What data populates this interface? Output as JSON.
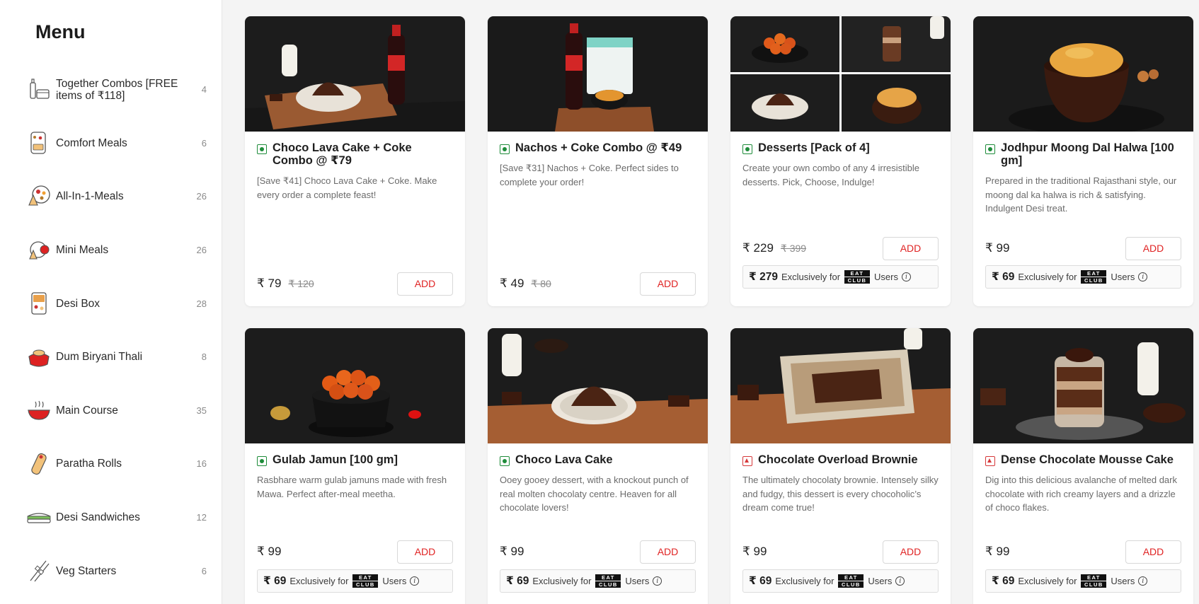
{
  "sidebar": {
    "title": "Menu",
    "categories": [
      {
        "label": "Together Combos [FREE items of ₹118]",
        "count": "4",
        "icon": "combo-icon"
      },
      {
        "label": "Comfort Meals",
        "count": "6",
        "icon": "meal-box-icon"
      },
      {
        "label": "All-In-1-Meals",
        "count": "26",
        "icon": "all-in-one-meal-icon"
      },
      {
        "label": "Mini Meals",
        "count": "26",
        "icon": "mini-meal-icon"
      },
      {
        "label": "Desi Box",
        "count": "28",
        "icon": "desi-box-icon"
      },
      {
        "label": "Dum Biryani Thali",
        "count": "8",
        "icon": "biryani-pot-icon"
      },
      {
        "label": "Main Course",
        "count": "35",
        "icon": "curry-bowl-icon"
      },
      {
        "label": "Paratha Rolls",
        "count": "16",
        "icon": "roll-icon"
      },
      {
        "label": "Desi Sandwiches",
        "count": "12",
        "icon": "sandwich-icon"
      },
      {
        "label": "Veg Starters",
        "count": "6",
        "icon": "skewer-icon"
      }
    ]
  },
  "eatclub": {
    "exclusive_text": "Exclusively for",
    "users_text": "Users",
    "logo_top": "EAT",
    "logo_bottom": "CLUB"
  },
  "add_label": "ADD",
  "items": [
    {
      "title": "Choco Lava Cake + Coke Combo @ ₹79",
      "desc": "[Save ₹41] Choco Lava Cake + Coke. Make every order a complete feast!",
      "price": "₹ 79",
      "mrp": "₹ 120",
      "eat_price": "",
      "type": "veg",
      "image": "choco-lava-coke-photo"
    },
    {
      "title": "Nachos + Coke Combo @ ₹49",
      "desc": "[Save ₹31] Nachos + Coke. Perfect sides to complete your order!",
      "price": "₹ 49",
      "mrp": "₹ 80",
      "eat_price": "",
      "type": "veg",
      "image": "nachos-coke-photo"
    },
    {
      "title": "Desserts [Pack of 4]",
      "desc": "Create your own combo of any 4 irresistible desserts. Pick, Choose, Indulge!",
      "price": "₹ 229",
      "mrp": "₹ 399",
      "eat_price": "₹ 279",
      "type": "veg",
      "image": "dessert-collage-photo"
    },
    {
      "title": "Jodhpur Moong Dal Halwa [100 gm]",
      "desc": "Prepared in the traditional Rajasthani style, our moong dal ka halwa is rich & satisfying. Indulgent Desi treat.",
      "price": "₹ 99",
      "mrp": "",
      "eat_price": "₹ 69",
      "type": "veg",
      "image": "moong-dal-halwa-photo"
    },
    {
      "title": "Gulab Jamun [100 gm]",
      "desc": "Rasbhare warm gulab jamuns made with fresh Mawa. Perfect after-meal meetha.",
      "price": "₹ 99",
      "mrp": "",
      "eat_price": "₹ 69",
      "type": "veg",
      "image": "gulab-jamun-photo"
    },
    {
      "title": "Choco Lava Cake",
      "desc": "Ooey gooey dessert, with a knockout punch of real molten chocolaty centre. Heaven for all chocolate lovers!",
      "price": "₹ 99",
      "mrp": "",
      "eat_price": "₹ 69",
      "type": "veg",
      "image": "choco-lava-cake-photo"
    },
    {
      "title": "Chocolate Overload Brownie",
      "desc": "The ultimately chocolaty brownie. Intensely silky and fudgy, this dessert is every chocoholic’s dream come true!",
      "price": "₹ 99",
      "mrp": "",
      "eat_price": "₹ 69",
      "type": "nonveg",
      "image": "brownie-photo"
    },
    {
      "title": "Dense Chocolate Mousse Cake",
      "desc": "Dig into this delicious avalanche of melted dark chocolate with rich creamy layers and a drizzle of choco flakes.",
      "price": "₹ 99",
      "mrp": "",
      "eat_price": "₹ 69",
      "type": "nonveg",
      "image": "mousse-cake-photo"
    }
  ],
  "colors": {
    "accent": "#e02323",
    "veg": "#1e8c3a",
    "nonveg": "#d6383a",
    "photo_bg": "#1d1d1d"
  }
}
